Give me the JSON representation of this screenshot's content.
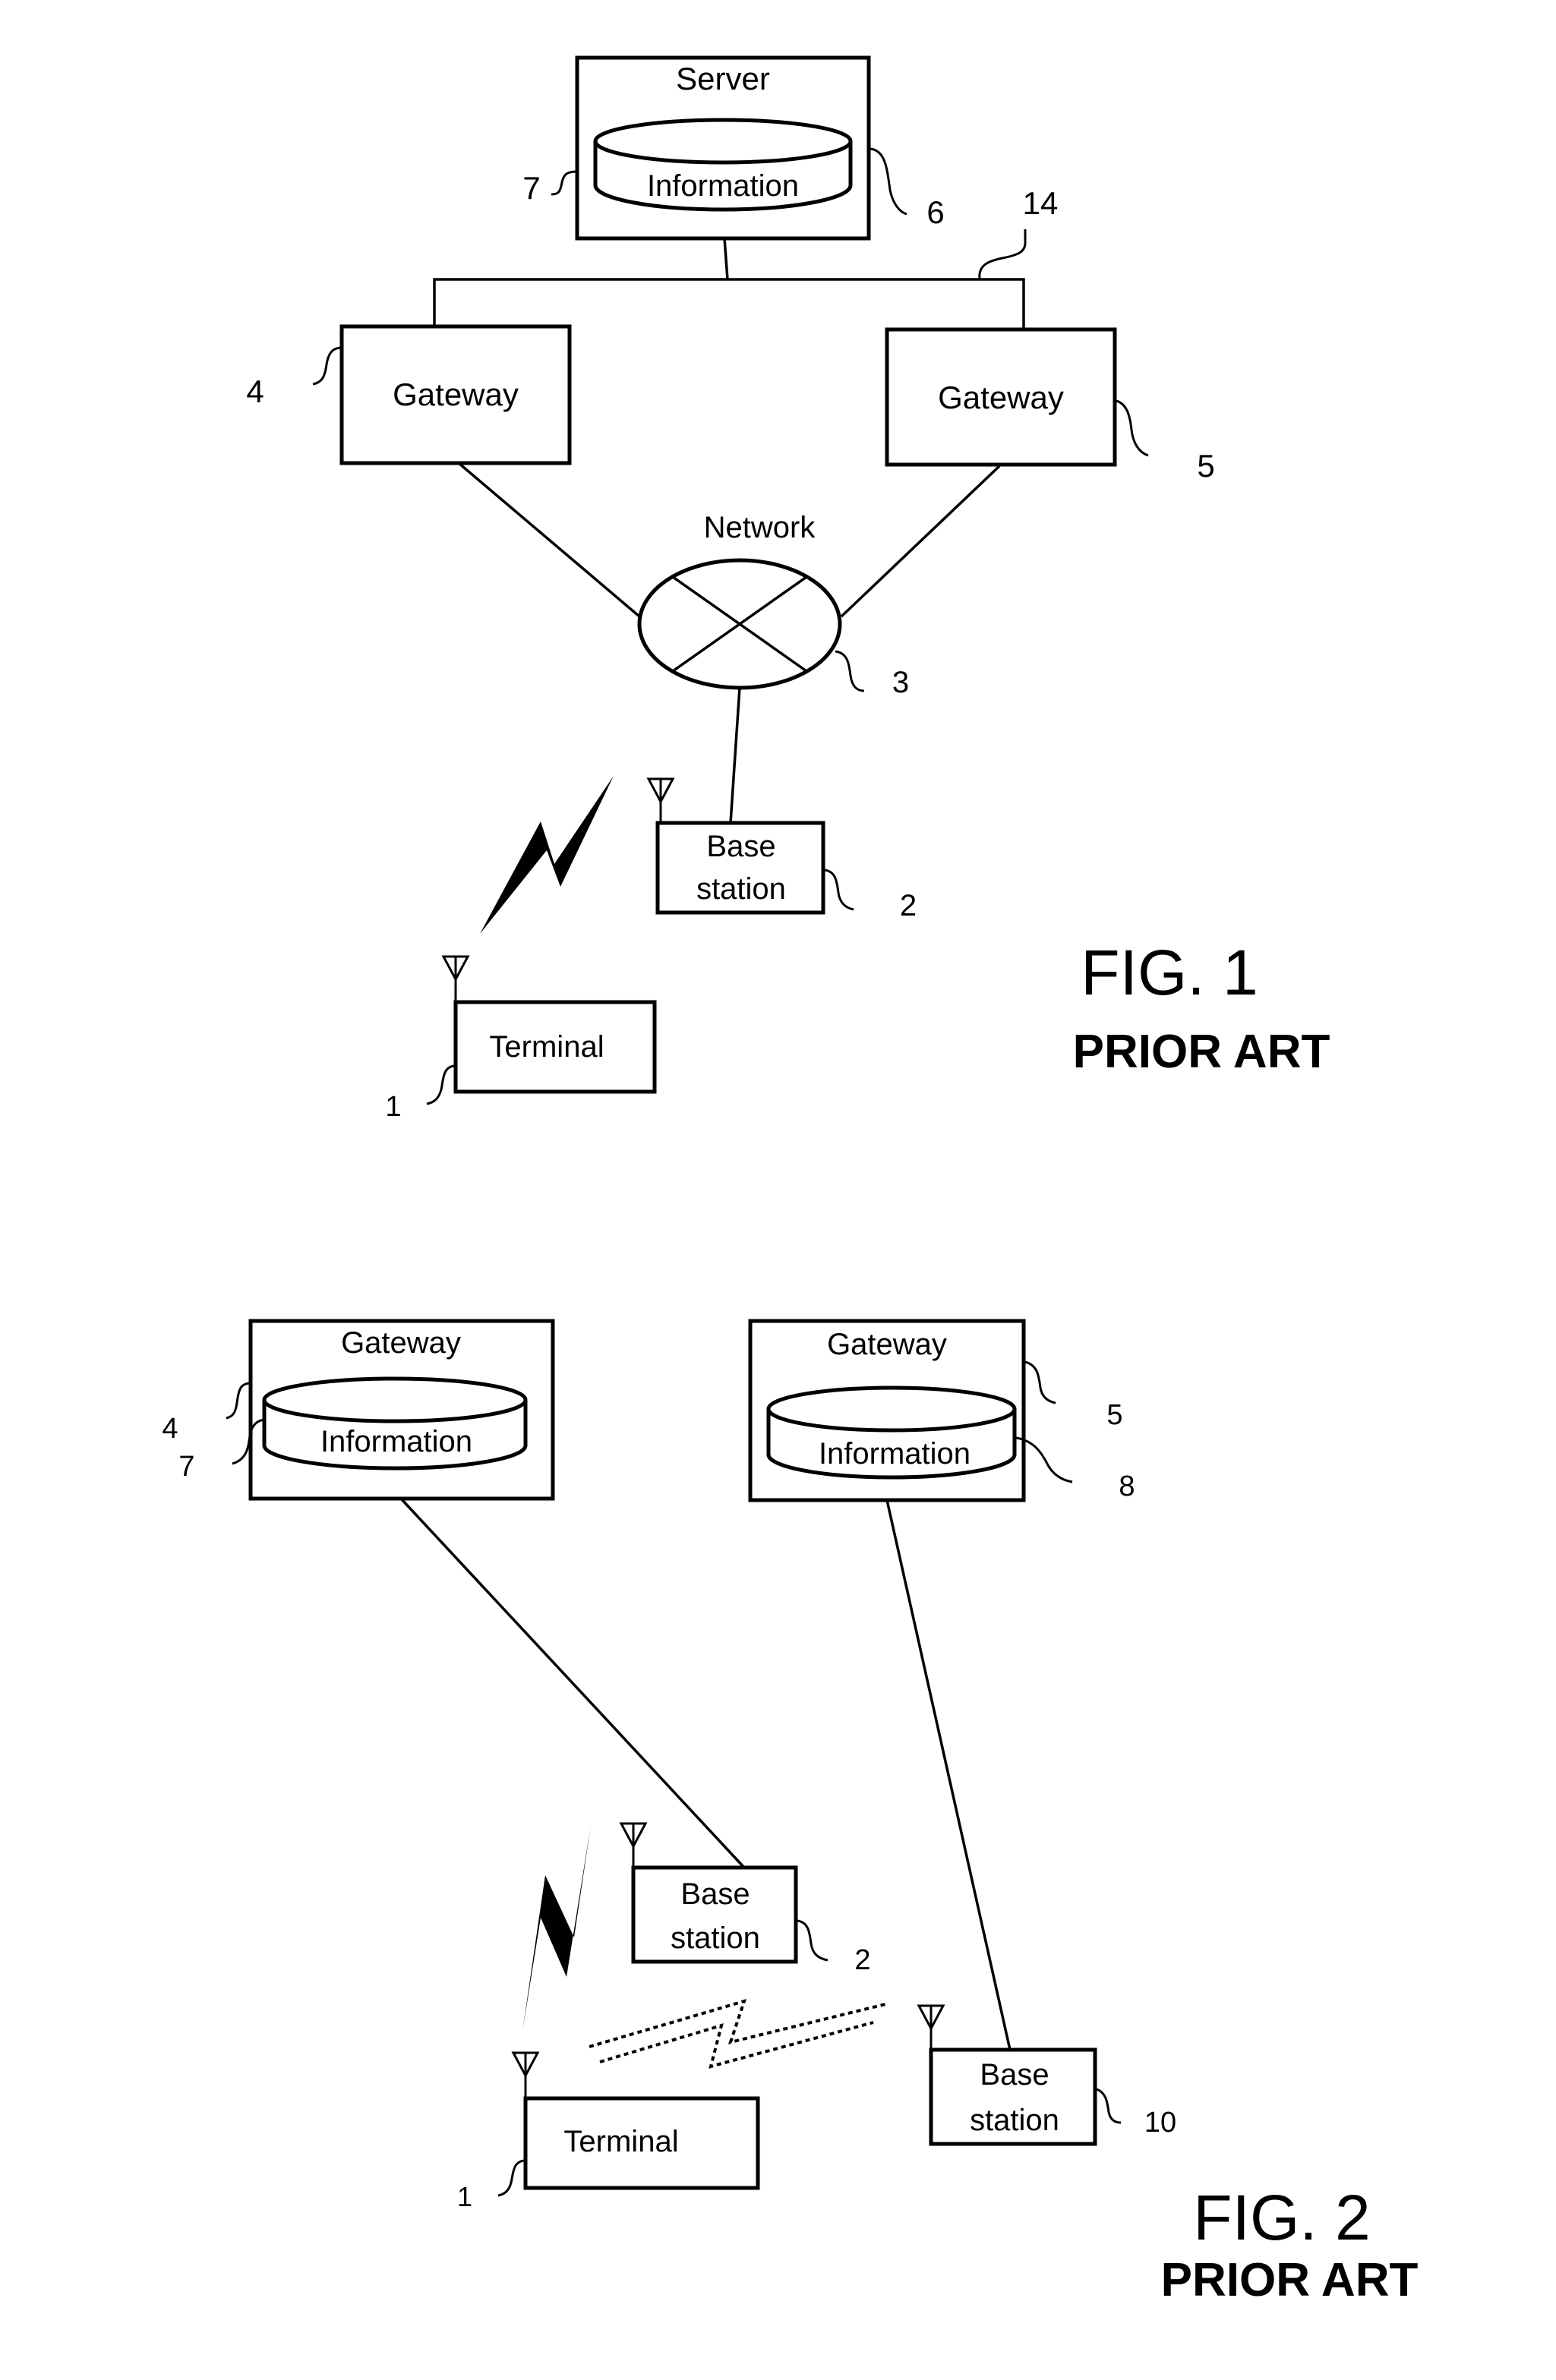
{
  "figures": [
    {
      "id": "fig1",
      "caption": "FIG. 1",
      "subcaption": "PRIOR ART",
      "nodes": {
        "server": {
          "label": "Server",
          "ref": "6"
        },
        "server_db": {
          "label": "Information",
          "ref": "7"
        },
        "bus": {
          "ref": "14"
        },
        "gateway_a": {
          "label": "Gateway",
          "ref": "4"
        },
        "gateway_b": {
          "label": "Gateway",
          "ref": "5"
        },
        "network": {
          "label": "Network",
          "ref": "3"
        },
        "base_station": {
          "label_line1": "Base",
          "label_line2": "station",
          "ref": "2"
        },
        "terminal": {
          "label": "Terminal",
          "ref": "1"
        }
      }
    },
    {
      "id": "fig2",
      "caption": "FIG. 2",
      "subcaption": "PRIOR ART",
      "nodes": {
        "gateway_a": {
          "label": "Gateway",
          "ref": "4"
        },
        "gateway_a_db": {
          "label": "Information",
          "ref": "7"
        },
        "gateway_b": {
          "label": "Gateway",
          "ref": "5"
        },
        "gateway_b_db": {
          "label": "Information",
          "ref": "8"
        },
        "base_station_a": {
          "label_line1": "Base",
          "label_line2": "station",
          "ref": "2"
        },
        "base_station_b": {
          "label_line1": "Base",
          "label_line2": "station",
          "ref": "10"
        },
        "terminal": {
          "label": "Terminal",
          "ref": "1"
        }
      }
    }
  ]
}
